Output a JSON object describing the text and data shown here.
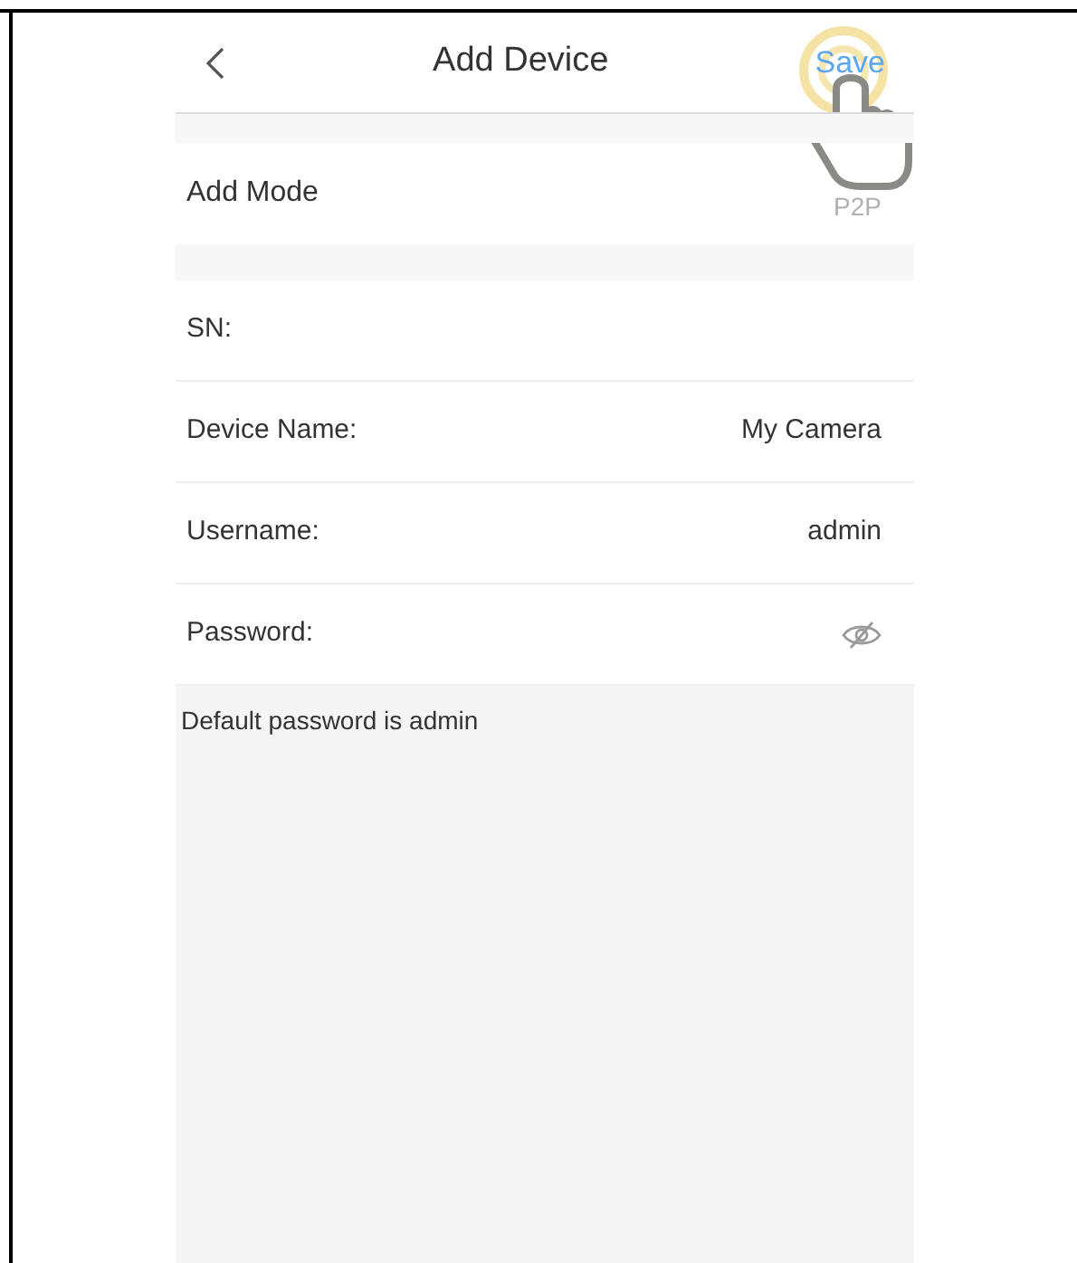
{
  "header": {
    "title": "Add Device",
    "save": "Save"
  },
  "add_mode": {
    "label": "Add Mode",
    "value": "P2P"
  },
  "fields": [
    {
      "kind": "text",
      "label": "SN:"
    },
    {
      "kind": "text",
      "label": "Device Name:",
      "value": "My Camera"
    },
    {
      "kind": "text",
      "label": "Username:",
      "value": "admin"
    },
    {
      "kind": "password",
      "label": "Password:"
    }
  ],
  "hint": "Default password is admin"
}
